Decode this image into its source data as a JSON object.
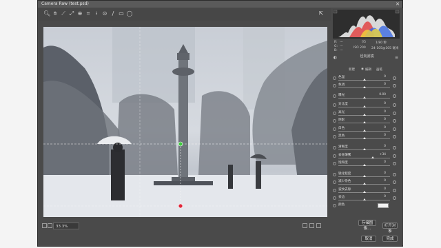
{
  "window": {
    "title": "Camera Raw (test.psd)"
  },
  "toolbar": {
    "tools": [
      "zoom-tool-icon",
      "hand-tool-icon",
      "white-balance-icon",
      "color-sampler-icon",
      "targeted-adjust-icon",
      "crop-icon",
      "spot-removal-icon",
      "red-eye-icon",
      "adjustment-brush-icon",
      "graduated-filter-icon",
      "radial-filter-icon",
      "open-preferences-icon"
    ]
  },
  "camera_info": {
    "aperture": "f/5",
    "shutter": "1/80 秒",
    "iso": "ISO 200",
    "focal": "24-105@105 毫米",
    "rgb_r": "R:",
    "rgb_g": "G:",
    "rgb_b": "B:",
    "dash": "---"
  },
  "panel": {
    "section_title": "径向滤镜",
    "mode_new": "新建",
    "mode_edit": "编辑",
    "mode_brush": "画笔"
  },
  "sliders": [
    {
      "label": "色温",
      "value": "0",
      "pos": 0.5
    },
    {
      "label": "色调",
      "value": "0",
      "pos": 0.5
    },
    {
      "label": "曝光",
      "value": "0.00",
      "pos": 0.5
    },
    {
      "label": "对比度",
      "value": "0",
      "pos": 0.5
    },
    {
      "label": "高光",
      "value": "0",
      "pos": 0.5
    },
    {
      "label": "阴影",
      "value": "0",
      "pos": 0.5
    },
    {
      "label": "白色",
      "value": "0",
      "pos": 0.5
    },
    {
      "label": "黑色",
      "value": "0",
      "pos": 0.5
    },
    {
      "label": "清晰度",
      "value": "0",
      "pos": 0.5
    },
    {
      "label": "去除薄雾",
      "value": "+34",
      "pos": 0.67
    },
    {
      "label": "饱和度",
      "value": "0",
      "pos": 0.5
    },
    {
      "label": "锐化程度",
      "value": "0",
      "pos": 0.5
    },
    {
      "label": "减少杂色",
      "value": "0",
      "pos": 0.5
    },
    {
      "label": "波纹去除",
      "value": "0",
      "pos": 0.5
    },
    {
      "label": "去边",
      "value": "0",
      "pos": 0.5
    }
  ],
  "color_label": "颜色",
  "statusbar": {
    "zoom": "33.3%"
  },
  "buttons": {
    "open": "打开对象",
    "cancel": "取消",
    "done": "完成",
    "save": "存储图像..."
  },
  "colors": {
    "window_bg": "#4a4a4a",
    "filter_pin_top": "#3ec93e",
    "filter_pin_bottom": "#e0263a"
  }
}
